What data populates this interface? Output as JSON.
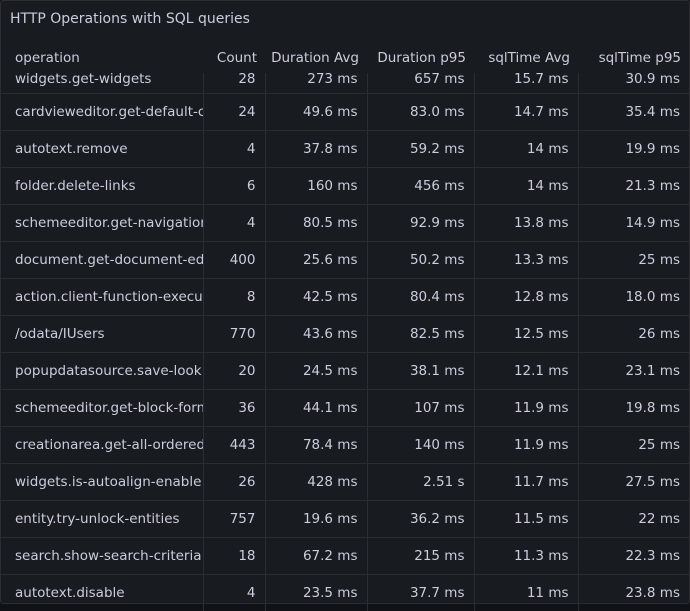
{
  "panel": {
    "title": "HTTP Operations with SQL queries"
  },
  "columns": [
    "operation",
    "Count",
    "Duration Avg",
    "Duration p95",
    "sqlTime Avg",
    "sqlTime p95"
  ],
  "rows": [
    [
      "widgets.get-widgets",
      "28",
      "273 ms",
      "657 ms",
      "15.7 ms",
      "30.9 ms"
    ],
    [
      "cardvieweditor.get-default-c",
      "24",
      "49.6 ms",
      "83.0 ms",
      "14.7 ms",
      "35.4 ms"
    ],
    [
      "autotext.remove",
      "4",
      "37.8 ms",
      "59.2 ms",
      "14 ms",
      "19.9 ms"
    ],
    [
      "folder.delete-links",
      "6",
      "160 ms",
      "456 ms",
      "14 ms",
      "21.3 ms"
    ],
    [
      "schemeeditor.get-navigation",
      "4",
      "80.5 ms",
      "92.9 ms",
      "13.8 ms",
      "14.9 ms"
    ],
    [
      "document.get-document-ed",
      "400",
      "25.6 ms",
      "50.2 ms",
      "13.3 ms",
      "25 ms"
    ],
    [
      "action.client-function-execu",
      "8",
      "42.5 ms",
      "80.4 ms",
      "12.8 ms",
      "18.0 ms"
    ],
    [
      "/odata/IUsers",
      "770",
      "43.6 ms",
      "82.5 ms",
      "12.5 ms",
      "26 ms"
    ],
    [
      "popupdatasource.save-look",
      "20",
      "24.5 ms",
      "38.1 ms",
      "12.1 ms",
      "23.1 ms"
    ],
    [
      "schemeeditor.get-block-form",
      "36",
      "44.1 ms",
      "107 ms",
      "11.9 ms",
      "19.8 ms"
    ],
    [
      "creationarea.get-all-ordered",
      "443",
      "78.4 ms",
      "140 ms",
      "11.9 ms",
      "25 ms"
    ],
    [
      "widgets.is-autoalign-enable",
      "26",
      "428 ms",
      "2.51 s",
      "11.7 ms",
      "27.5 ms"
    ],
    [
      "entity.try-unlock-entities",
      "757",
      "19.6 ms",
      "36.2 ms",
      "11.5 ms",
      "22 ms"
    ],
    [
      "search.show-search-criteria",
      "18",
      "67.2 ms",
      "215 ms",
      "11.3 ms",
      "22.3 ms"
    ],
    [
      "autotext.disable",
      "4",
      "23.5 ms",
      "37.7 ms",
      "11 ms",
      "23.8 ms"
    ]
  ]
}
